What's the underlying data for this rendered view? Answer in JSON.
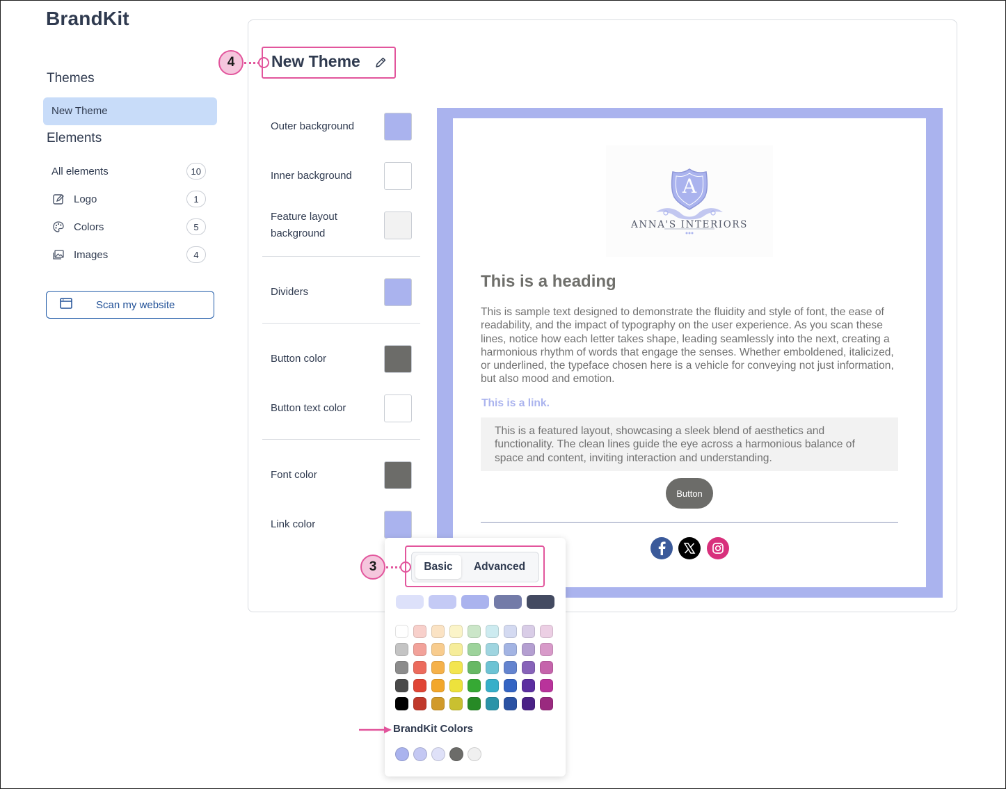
{
  "app": {
    "brand": "BrandKit"
  },
  "sidebar": {
    "themes_heading": "Themes",
    "theme_item": "New Theme",
    "elements_heading": "Elements",
    "elements": [
      {
        "label": "All elements",
        "count": "10",
        "icon": ""
      },
      {
        "label": "Logo",
        "count": "1",
        "icon": "image-edit-icon"
      },
      {
        "label": "Colors",
        "count": "5",
        "icon": "palette-icon"
      },
      {
        "label": "Images",
        "count": "4",
        "icon": "images-icon"
      }
    ],
    "scan_button": "Scan my website",
    "scan_icon": "browser-window-icon"
  },
  "main": {
    "title": "New Theme",
    "callout_title": "4",
    "callout_tabs": "3",
    "settings": [
      {
        "label": "Outer background",
        "color": "#aab3ee"
      },
      {
        "label": "Inner background",
        "color": "#ffffff"
      },
      {
        "label": "Feature layout background",
        "color": "#f2f2f2"
      },
      {
        "label": "Dividers",
        "color": "#aab3ee"
      },
      {
        "label": "Button color",
        "color": "#6c6c69"
      },
      {
        "label": "Button text color",
        "color": "#ffffff"
      },
      {
        "label": "Font color",
        "color": "#6c6c69"
      },
      {
        "label": "Link color",
        "color": "#aab3ee"
      }
    ]
  },
  "preview": {
    "logo_letter": "A",
    "logo_name": "ANNA'S INTERIORS",
    "heading": "This is a heading",
    "body": "This is sample text designed to demonstrate the fluidity and style of font, the ease of readability, and the impact of typography on the user experience. As you scan these lines, notice how each letter takes shape, leading seamlessly into the next, creating a harmonious rhythm of words that engage the senses. Whether emboldened, italicized, or underlined, the typeface chosen here is a vehicle for conveying not just information, but also mood and emotion.",
    "link": "This is a link.",
    "feature": "This is a featured layout, showcasing a sleek blend of aesthetics and functionality. The clean lines guide the eye across a harmonious balance of space and content, inviting interaction and understanding.",
    "button": "Button",
    "social": [
      "facebook-icon",
      "x-icon",
      "instagram-icon"
    ]
  },
  "color_picker": {
    "tabs": [
      "Basic",
      "Advanced"
    ],
    "active_tab": "Basic",
    "base_shades": [
      "#dde1fa",
      "#c4caf5",
      "#aab3ee",
      "#737ba8",
      "#434a61"
    ],
    "palette": [
      [
        "#ffffff",
        "#f8d0cb",
        "#fbe3c4",
        "#fbf4c8",
        "#cbe6c8",
        "#cdebf0",
        "#d4daf1",
        "#d9cde7",
        "#eccfe4"
      ],
      [
        "#c4c4c4",
        "#f2a29a",
        "#f8cc8e",
        "#f6ed9a",
        "#9dd39b",
        "#9fd5e0",
        "#a3b4e3",
        "#b49fd1",
        "#d89ac9"
      ],
      [
        "#8c8c8c",
        "#ec6b5d",
        "#f5b14a",
        "#f3e54f",
        "#67b864",
        "#6dc3d4",
        "#6484cf",
        "#8763b9",
        "#c564ab"
      ],
      [
        "#4a4a4a",
        "#e04535",
        "#f2a72b",
        "#ede23c",
        "#36a934",
        "#36afc9",
        "#3464c3",
        "#5b2ea0",
        "#b9339b"
      ],
      [
        "#000000",
        "#c0392b",
        "#d19a2a",
        "#c9c030",
        "#278a26",
        "#2b93a8",
        "#2a52a3",
        "#4a2186",
        "#9a2a7f"
      ]
    ],
    "brandkit_heading": "BrandKit Colors",
    "brandkit_colors": [
      "#aab3ee",
      "#c4c8f3",
      "#dfe1f8",
      "#6c6c69",
      "#f0f0f0"
    ]
  },
  "colors": {
    "accent": "#e2559c",
    "nav_selected": "#c8dcf9",
    "primary_link": "#1f4f96"
  }
}
